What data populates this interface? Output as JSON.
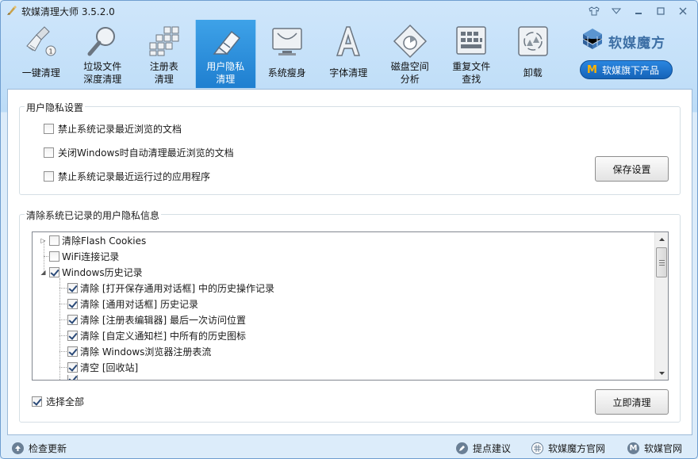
{
  "window": {
    "title": "软媒清理大师 3.5.2.0"
  },
  "toolbar": {
    "items": [
      {
        "label": "一键清理",
        "icon": "broom-icon"
      },
      {
        "label": "垃圾文件\n深度清理",
        "icon": "magnifier-icon"
      },
      {
        "label": "注册表\n清理",
        "icon": "registry-blocks-icon"
      },
      {
        "label": "用户隐私\n清理",
        "icon": "eraser-icon"
      },
      {
        "label": "系统瘦身",
        "icon": "monitor-icon"
      },
      {
        "label": "字体清理",
        "icon": "font-a-icon"
      },
      {
        "label": "磁盘空间\n分析",
        "icon": "disk-chart-icon"
      },
      {
        "label": "重复文件\n查找",
        "icon": "grid-window-icon"
      },
      {
        "label": "卸载",
        "icon": "recycle-icon"
      }
    ],
    "active_index": 3
  },
  "brand": {
    "name": "软媒魔方",
    "products_button": "软媒旗下产品"
  },
  "privacy_settings": {
    "title": "用户隐私设置",
    "options": [
      {
        "label": "禁止系统记录最近浏览的文档",
        "checked": false
      },
      {
        "label": "关闭Windows时自动清理最近浏览的文档",
        "checked": false
      },
      {
        "label": "禁止系统记录最近运行过的应用程序",
        "checked": false
      }
    ],
    "save_button": "保存设置"
  },
  "clear_section": {
    "title": "清除系统已记录的用户隐私信息",
    "tree": [
      {
        "label": "清除Flash Cookies",
        "level": 0,
        "checked": false,
        "expander": "collapsed"
      },
      {
        "label": "WiFi连接记录",
        "level": 0,
        "checked": false,
        "expander": "none"
      },
      {
        "label": "Windows历史记录",
        "level": 0,
        "checked": true,
        "expander": "expanded"
      },
      {
        "label": "清除 [打开保存通用对话框] 中的历史操作记录",
        "level": 1,
        "checked": true
      },
      {
        "label": "清除 [通用对话框] 历史记录",
        "level": 1,
        "checked": true
      },
      {
        "label": "清除 [注册表编辑器] 最后一次访问位置",
        "level": 1,
        "checked": true
      },
      {
        "label": "清除 [自定义通知栏] 中所有的历史图标",
        "level": 1,
        "checked": true
      },
      {
        "label": "清除 Windows浏览器注册表流",
        "level": 1,
        "checked": true
      },
      {
        "label": "清空 [回收站]",
        "level": 1,
        "checked": true
      }
    ],
    "select_all": {
      "label": "选择全部",
      "checked": true
    },
    "clean_button": "立即清理"
  },
  "statusbar": {
    "check_update": "检查更新",
    "suggestion": "提点建议",
    "official_site_mofang": "软媒魔方官网",
    "official_site": "软媒官网"
  }
}
